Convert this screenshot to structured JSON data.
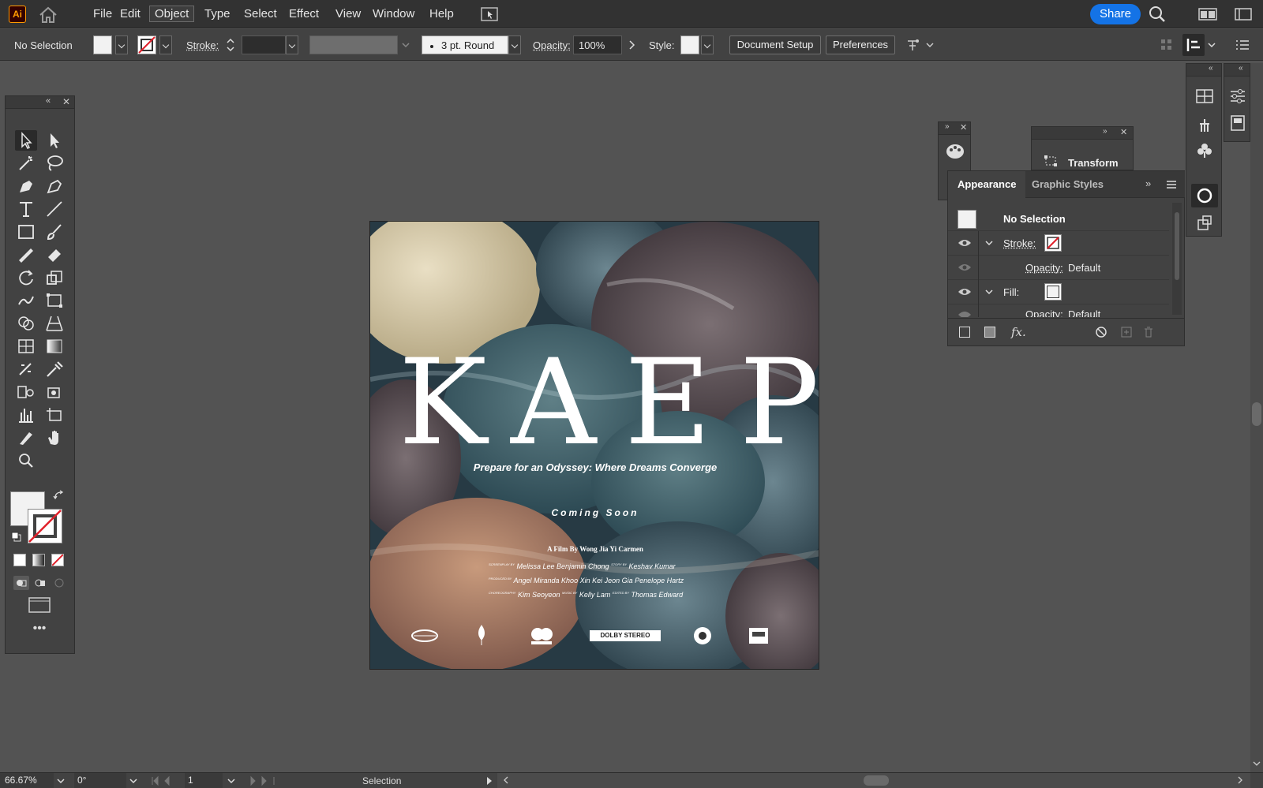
{
  "app": {
    "logo": "Ai"
  },
  "menu": [
    "File",
    "Edit",
    "Object",
    "Type",
    "Select",
    "Effect",
    "View",
    "Window",
    "Help"
  ],
  "menu_active": "Object",
  "header": {
    "share_label": "Share"
  },
  "control": {
    "selection": "No Selection",
    "stroke_label": "Stroke:",
    "brush": "3 pt. Round",
    "opacity_label": "Opacity:",
    "opacity_value": "100%",
    "style_label": "Style:",
    "document_setup": "Document Setup",
    "preferences": "Preferences"
  },
  "poster": {
    "title": "KAEP",
    "tagline": "Prepare for an Odyssey: Where Dreams Converge",
    "coming_soon": "Coming Soon",
    "film_by": "A Film By Wong Jia Yi Carmen",
    "credits": [
      {
        "role": "SCREENPLAY BY",
        "names": "Melissa Lee  Benjamin Chong"
      },
      {
        "role": "STORY BY",
        "names": "Keshav Kumar"
      },
      {
        "role": "PRODUCED BY",
        "names": "Angel Miranda  Khoo Xin Kei  Jeon Gia  Penelope Hartz"
      },
      {
        "role": "CHOREOGRAPHY",
        "names": "Kim Seoyeon"
      },
      {
        "role": "MUSIC BY",
        "names": "Kelly Lam"
      },
      {
        "role": "EDITED BY",
        "names": "Thomas Edward"
      }
    ],
    "dolby": "DOLBY STEREO"
  },
  "panels": {
    "transform_title": "Transform",
    "appearance_tab": "Appearance",
    "graphic_styles_tab": "Graphic Styles",
    "no_selection": "No Selection",
    "stroke": "Stroke:",
    "opacity": "Opacity:",
    "opacity_value": "Default",
    "fill": "Fill:",
    "fx": "fx."
  },
  "status": {
    "zoom": "66.67%",
    "rotation": "0°",
    "artboard": "1",
    "tool": "Selection"
  },
  "colors": {
    "accent": "#1473e6",
    "panel": "#424242",
    "canvas": "#535353"
  }
}
